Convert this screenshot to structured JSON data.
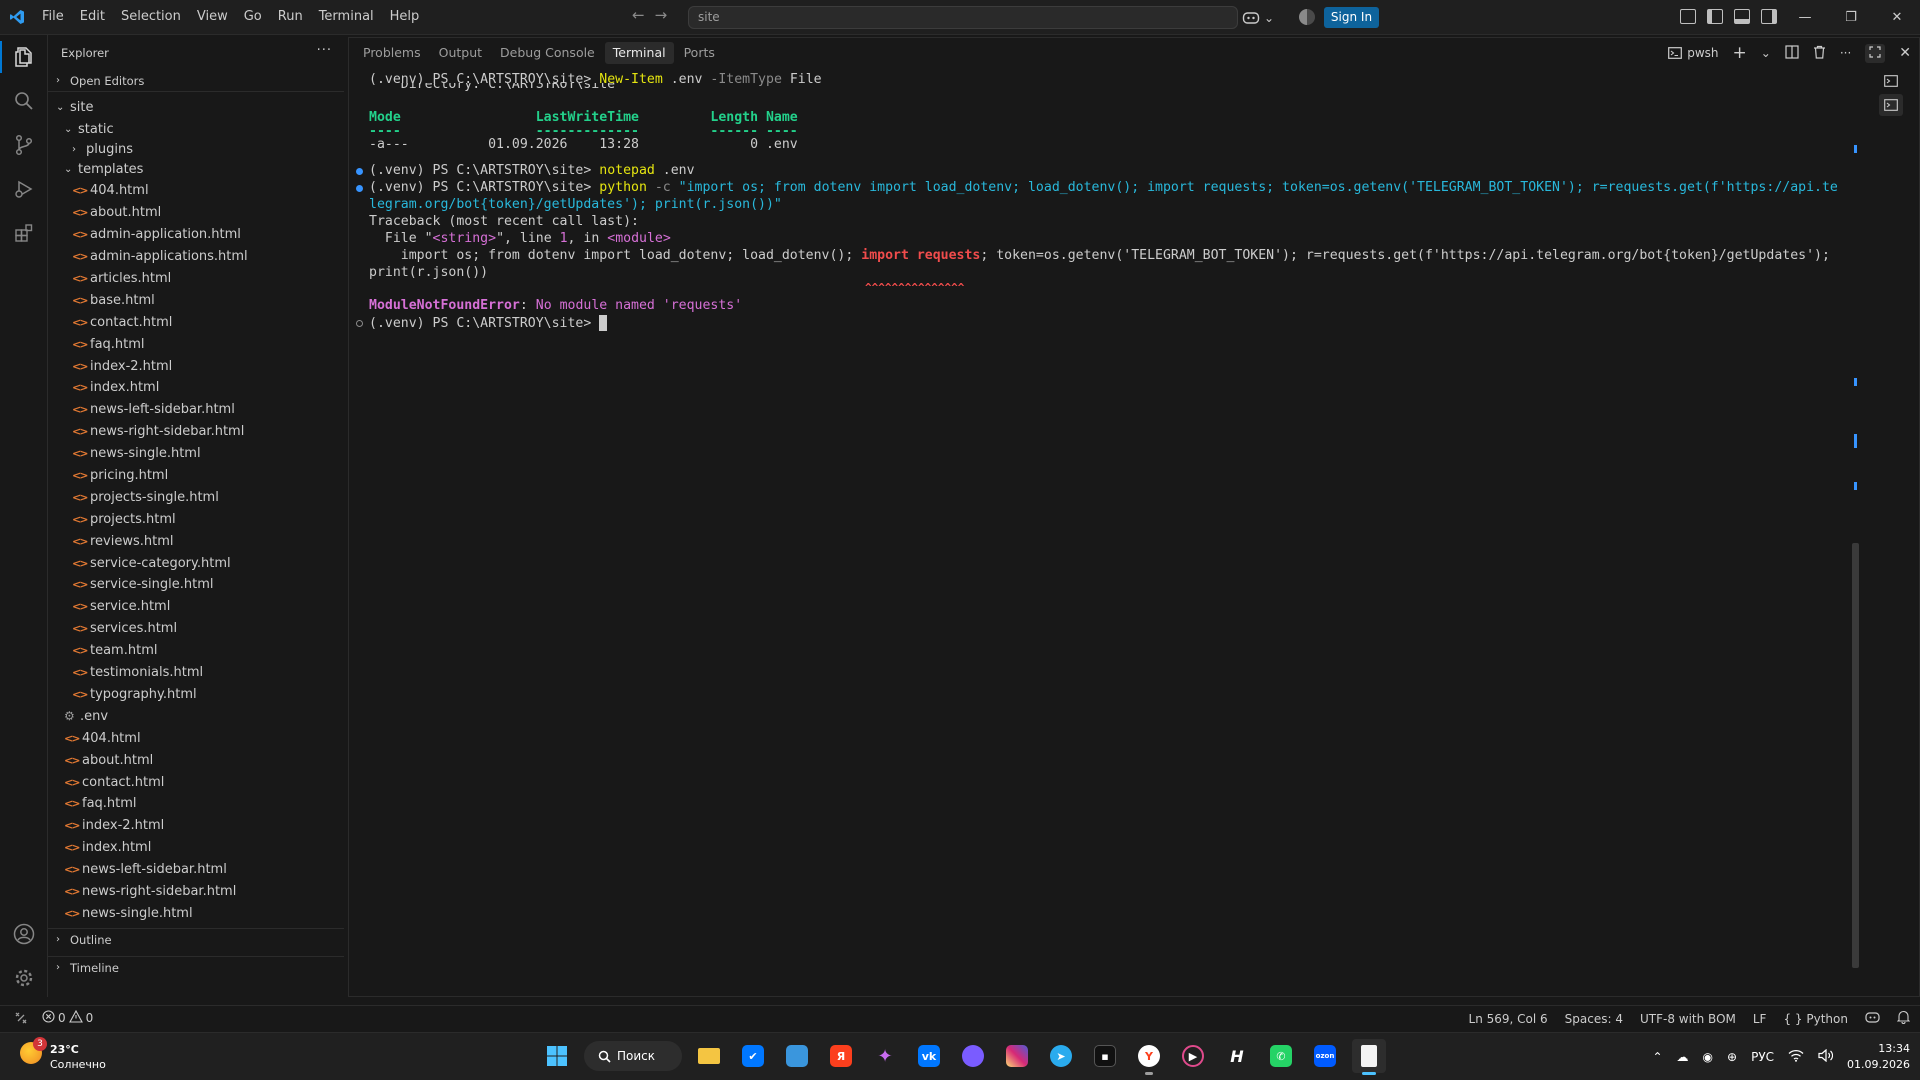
{
  "titlebar": {
    "menu": [
      "File",
      "Edit",
      "Selection",
      "View",
      "Go",
      "Run",
      "Terminal",
      "Help"
    ],
    "search_text": "site",
    "signin_label": "Sign In"
  },
  "explorer": {
    "title": "Explorer",
    "more": "···",
    "open_editors": "Open Editors",
    "root": "site",
    "folders": {
      "static": "static",
      "plugins": "plugins",
      "templates": "templates"
    },
    "template_files": [
      "404.html",
      "about.html",
      "admin-application.html",
      "admin-applications.html",
      "articles.html",
      "base.html",
      "contact.html",
      "faq.html",
      "index-2.html",
      "index.html",
      "news-left-sidebar.html",
      "news-right-sidebar.html",
      "news-single.html",
      "pricing.html",
      "projects-single.html",
      "projects.html",
      "reviews.html",
      "service-category.html",
      "service-single.html",
      "service.html",
      "services.html",
      "team.html",
      "testimonials.html",
      "typography.html"
    ],
    "env_file": ".env",
    "root_files": [
      "404.html",
      "about.html",
      "contact.html",
      "faq.html",
      "index-2.html",
      "index.html",
      "news-left-sidebar.html",
      "news-right-sidebar.html",
      "news-single.html"
    ],
    "outline": "Outline",
    "timeline": "Timeline"
  },
  "panel": {
    "tabs": [
      "Problems",
      "Output",
      "Debug Console",
      "Terminal",
      "Ports"
    ],
    "active_tab": "Terminal",
    "shell_label": "pwsh"
  },
  "terminal": {
    "prompt": "(.venv) PS C:\\ARTSTROY\\site> ",
    "line1_cmd": "New-Item",
    "line1_arg": " .env ",
    "line1_param": "-ItemType",
    "line1_val": " File",
    "directory_line": "    Directory: C:\\ARTSTROY\\site",
    "table_header": "Mode                 LastWriteTime         Length Name",
    "table_dashes": "----                 -------------         ------ ----",
    "table_row": "-a---          01.09.2026    13:28              0 .env",
    "line2_cmd": "notepad",
    "line2_arg": " .env",
    "line3_cmd": "python",
    "line3_param": " -c ",
    "line3_str_a": "\"import os; from dotenv import load_dotenv; load_dotenv(); import requests; token=os.getenv('TELEGRAM_BOT_TOKEN'); r=requests.get(f'https://api.te",
    "line3_str_b": "legram.org/bot{token}/getUpdates'); print(r.json())\"",
    "tb_title": "Traceback (most recent call last):",
    "tb_file_pre": "  File \"",
    "tb_file_str": "<string>",
    "tb_file_mid": "\", line ",
    "tb_file_num": "1",
    "tb_file_in": ", in ",
    "tb_file_mod": "<module>",
    "tb_code_a": "    import os; from dotenv import load_dotenv; load_dotenv(); ",
    "tb_code_err": "import requests",
    "tb_code_b": "; token=os.getenv('TELEGRAM_BOT_TOKEN'); r=requests.get(f'https://api.telegram.org/bot{token}/getUpdates');",
    "tb_code_c": "print(r.json())",
    "tb_carets": "^^^^^^^^^^^^^^^",
    "err_name": "ModuleNotFoundError",
    "err_sep": ": ",
    "err_msg": "No module named 'requests'"
  },
  "statusbar": {
    "errors": "0",
    "warnings": "0",
    "position": "Ln 569, Col 6",
    "spaces": "Spaces: 4",
    "encoding": "UTF-8 with BOM",
    "eol": "LF",
    "language_braces": "{ }",
    "language": "Python"
  },
  "taskbar": {
    "weather_badge": "3",
    "temperature": "23°C",
    "condition": "Солнечно",
    "search_label": "Поиск",
    "lang": "РУС",
    "time": "13:34",
    "date": "01.09.2026"
  },
  "colors": {
    "accent": "#0078d4",
    "signin": "#0e639c",
    "term_yellow": "#e5e510",
    "term_cyan": "#29b8db",
    "term_green": "#23d18b",
    "term_red": "#f14c4c",
    "term_magenta": "#d670d6"
  }
}
